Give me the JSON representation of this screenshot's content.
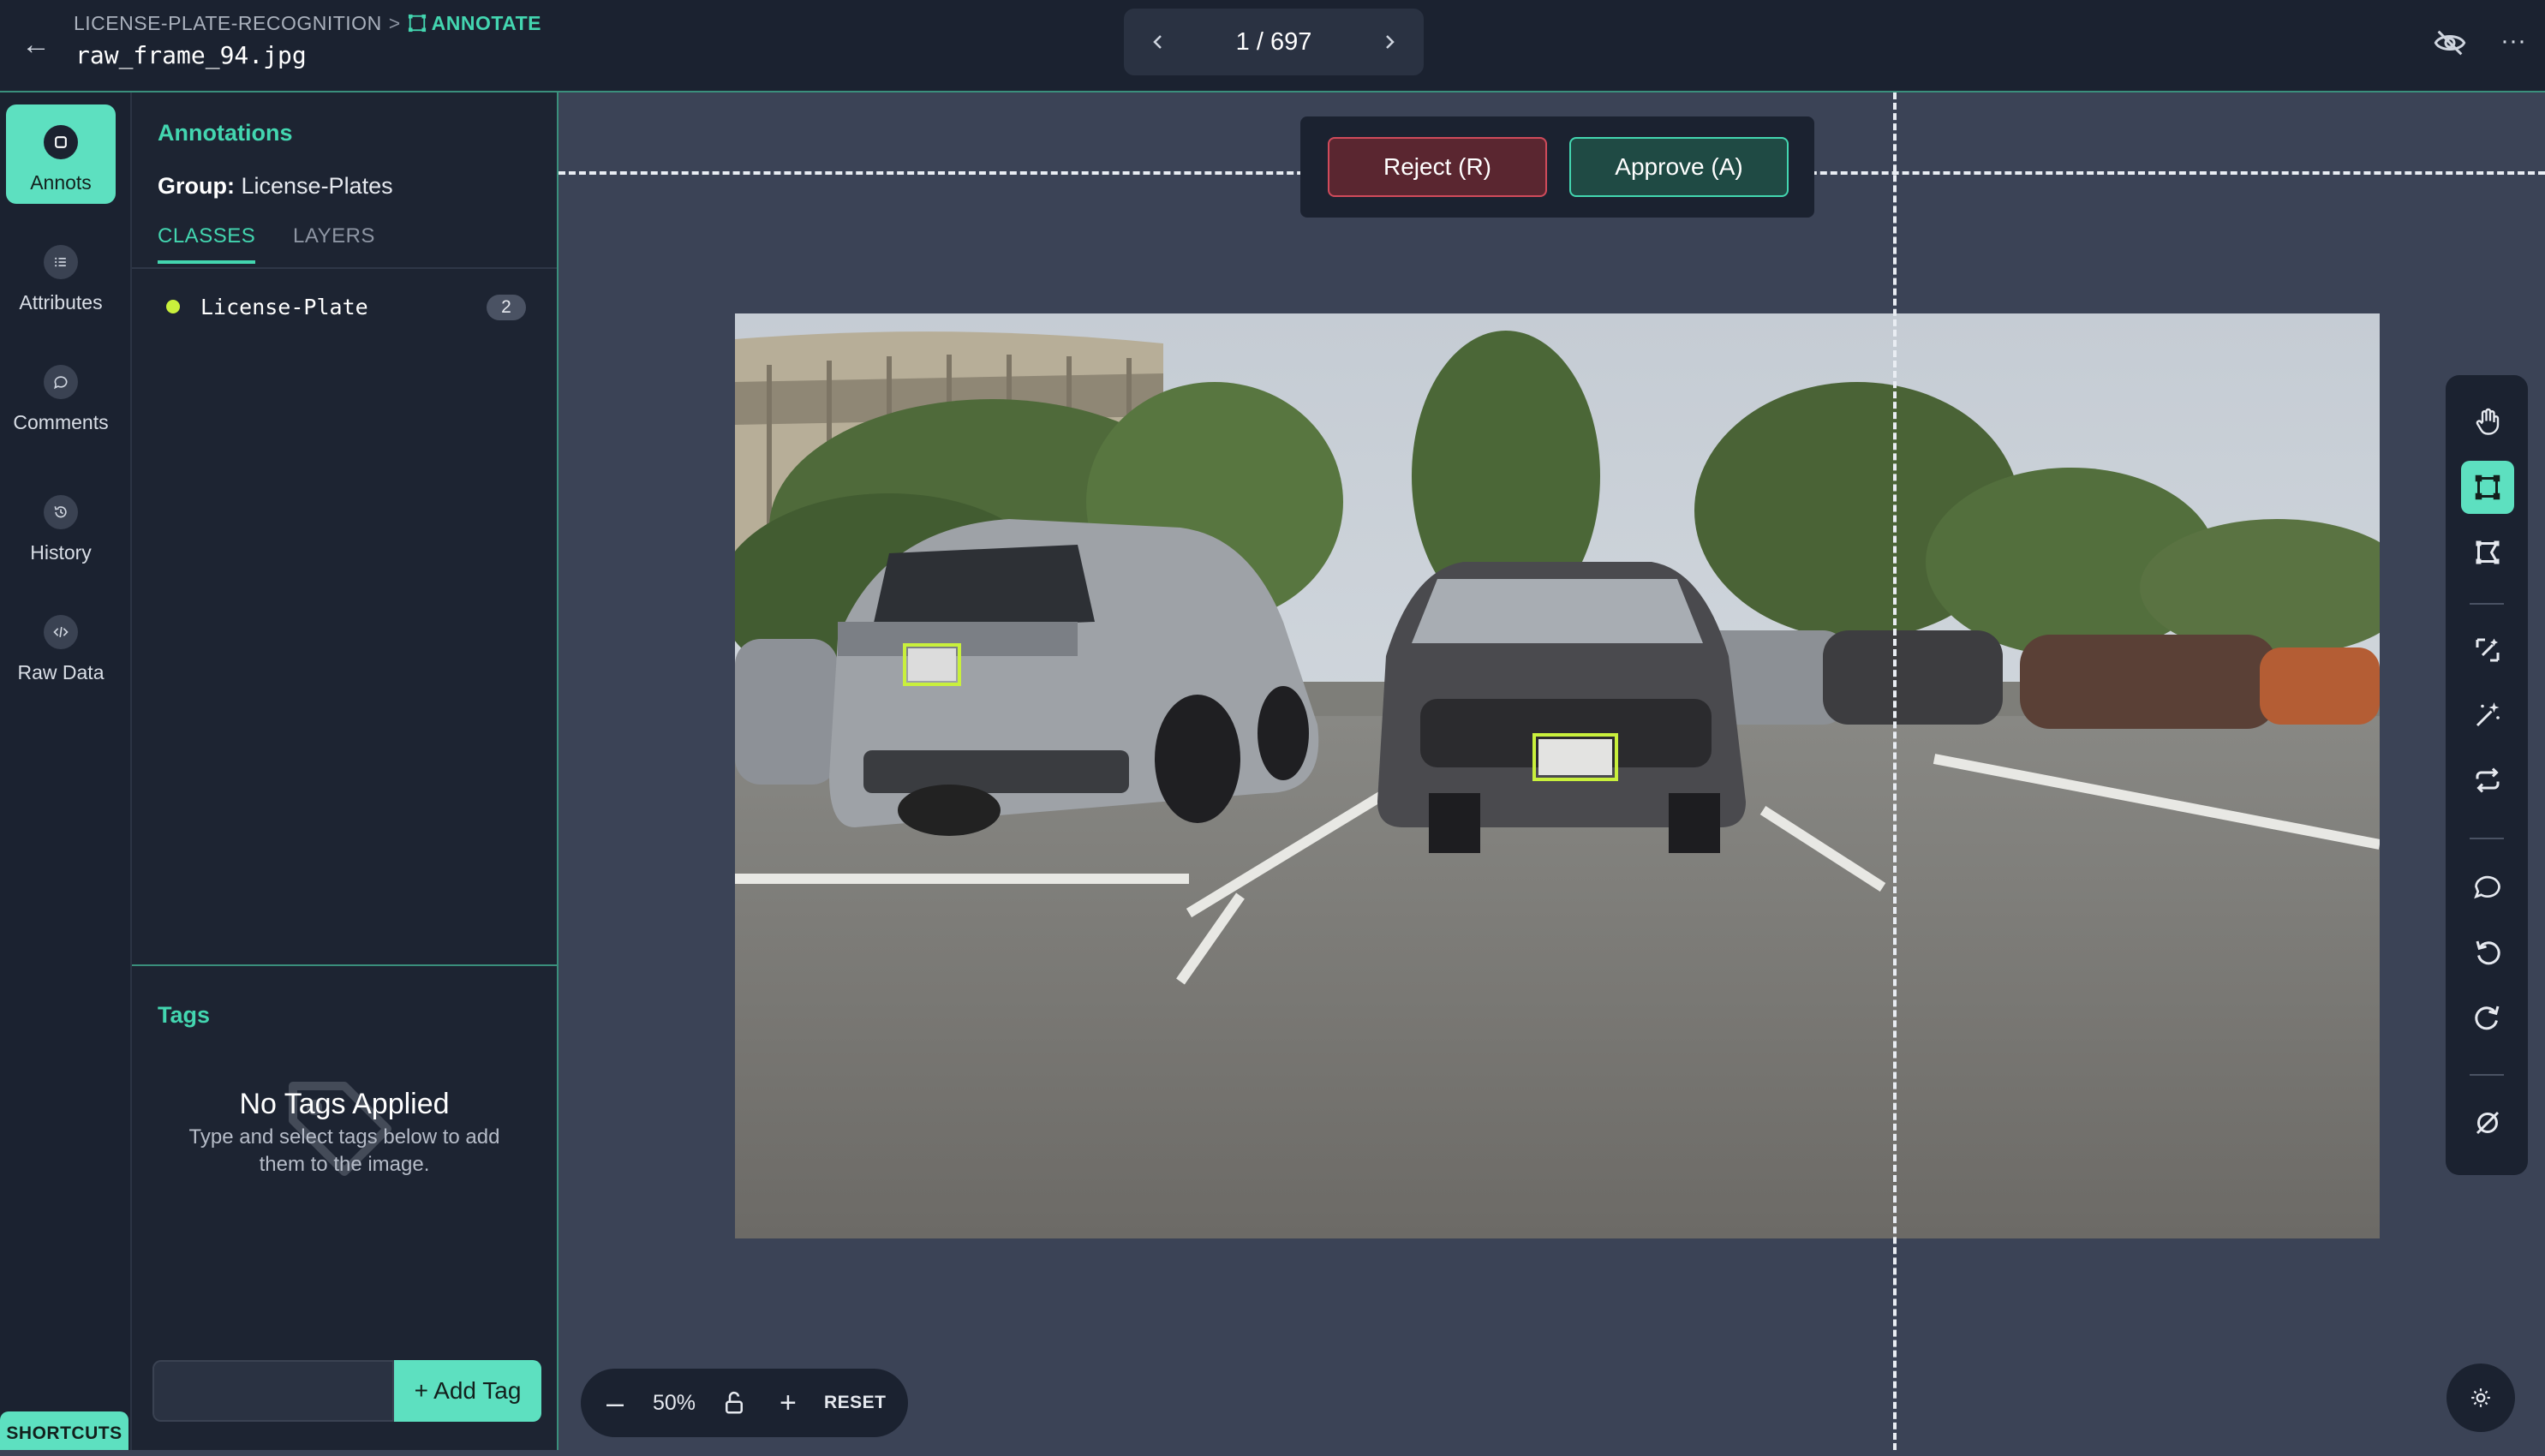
{
  "topbar": {
    "breadcrumb_project": "LICENSE-PLATE-RECOGNITION",
    "breadcrumb_sep": ">",
    "breadcrumb_current": "ANNOTATE",
    "filename": "raw_frame_94.jpg",
    "pager_text": "1 / 697",
    "more_label": "···",
    "back_label": "←"
  },
  "rail": {
    "items": [
      {
        "label": "Annots",
        "icon": "annotation-icon"
      },
      {
        "label": "Attributes",
        "icon": "list-icon"
      },
      {
        "label": "Comments",
        "icon": "comment-icon"
      },
      {
        "label": "History",
        "icon": "history-icon"
      },
      {
        "label": "Raw Data",
        "icon": "code-icon"
      }
    ],
    "shortcuts_label": "SHORTCUTS"
  },
  "panel": {
    "title": "Annotations",
    "group_label": "Group:",
    "group_value": "License-Plates",
    "tabs": [
      "CLASSES",
      "LAYERS"
    ],
    "classes": [
      {
        "name": "License-Plate",
        "count": "2",
        "color": "#c9f03c"
      }
    ],
    "tags_title": "Tags",
    "tags_empty_title": "No Tags Applied",
    "tags_empty_desc": "Type and select tags below to add them to the image.",
    "add_tag_label": "+ Add Tag",
    "tag_input_value": ""
  },
  "review": {
    "reject_label": "Reject (R)",
    "approve_label": "Approve (A)"
  },
  "zoom": {
    "minus": "–",
    "value": "50%",
    "plus": "+",
    "reset_label": "RESET"
  },
  "toolbar": {
    "tools": [
      "pan-hand-icon",
      "bounding-box-icon",
      "polygon-icon",
      "magic-wand-icon",
      "smart-wand-icon",
      "repeat-icon",
      "comment-icon",
      "undo-icon",
      "redo-icon",
      "hide-annotations-icon"
    ],
    "active_tool": "bounding-box-icon"
  },
  "colors": {
    "accent": "#43d6b0",
    "accent_fill": "#5de0c0",
    "reject": "#d04b5b",
    "annotation_box": "#c9f03c",
    "background": "#3b4356",
    "panel": "#1d2432"
  }
}
